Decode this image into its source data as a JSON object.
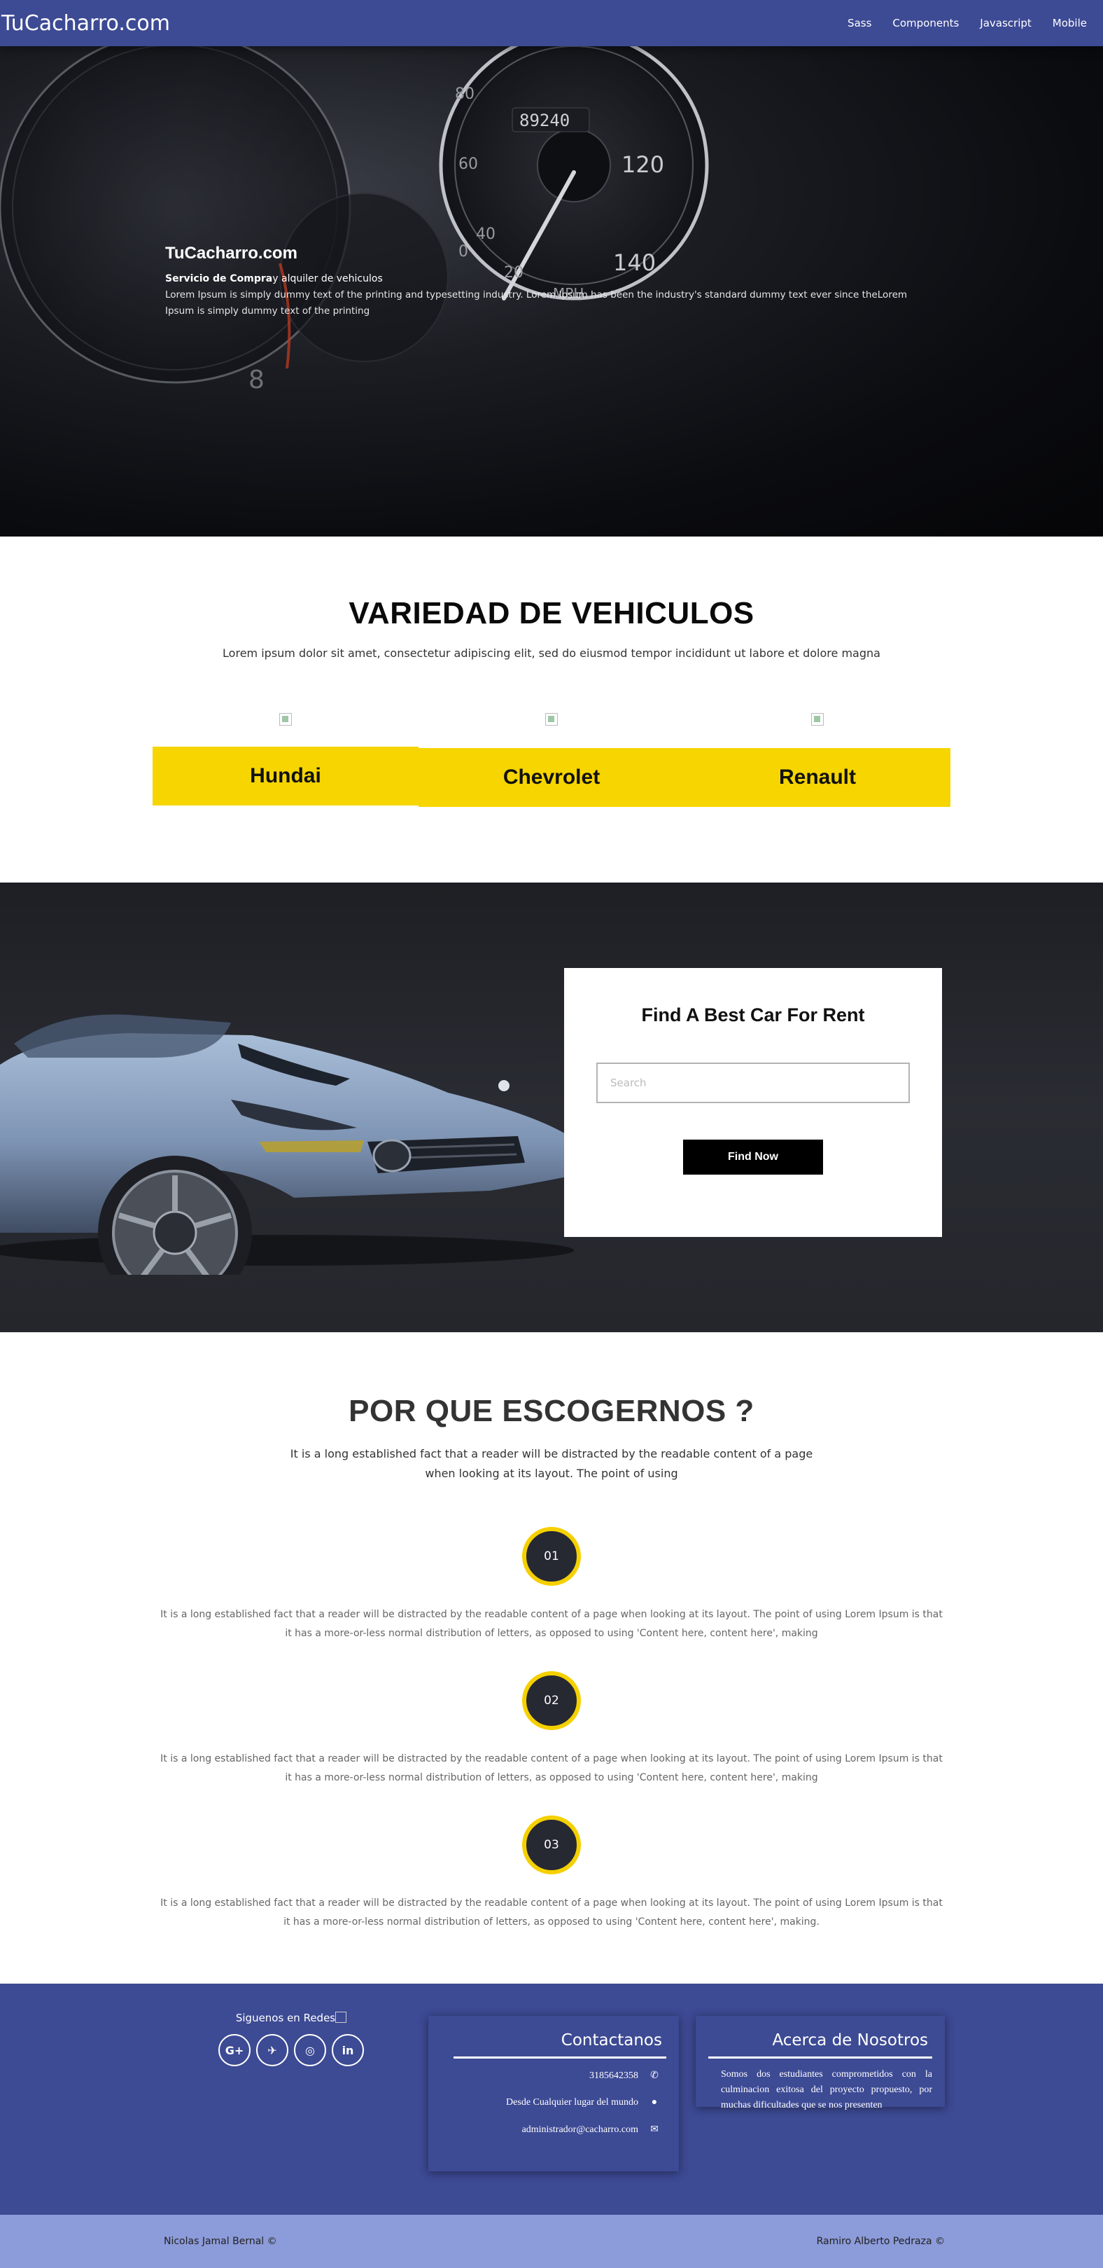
{
  "nav": {
    "brand": "TuCacharro.com",
    "links": [
      "Sass",
      "Components",
      "Javascript",
      "Mobile"
    ]
  },
  "hero": {
    "title": "TuCacharro.com",
    "subtitle_bold": "Servicio de Compra",
    "subtitle_rest": "y alquiler de vehiculos",
    "description": "Lorem Ipsum is simply dummy text of the printing and typesetting industry. Lorem Ipsum has been the industry's standard dummy text ever since theLorem Ipsum is simply dummy text of the printing",
    "gauge_digits": "89240",
    "gauge_marks": [
      "80",
      "60",
      "40",
      "20",
      "0",
      "120",
      "140",
      "MPH",
      "8"
    ]
  },
  "variedad": {
    "title": "VARIEDAD DE VEHICULOS",
    "subtitle": "Lorem ipsum dolor sit amet, consectetur adipiscing elit, sed do eiusmod tempor incididunt ut labore et dolore magna",
    "brands": [
      "Hundai",
      "Chevrolet",
      "Renault"
    ],
    "accent_color": "#f6d500"
  },
  "rent": {
    "title": "Find A Best Car For Rent",
    "search_placeholder": "Search",
    "button": "Find Now"
  },
  "why": {
    "title": "POR QUE ESCOGERNOS ?",
    "subtitle": "It is a long established fact that a reader will be distracted by the readable content of a page when looking at its layout. The point of using",
    "steps": [
      {
        "num": "01",
        "text": "It is a long established fact that a reader will be distracted by the readable content of a page when looking at its layout. The point of using Lorem Ipsum is that it has a more-or-less normal distribution of letters, as opposed to using 'Content here, content here', making"
      },
      {
        "num": "02",
        "text": "It is a long established fact that a reader will be distracted by the readable content of a page when looking at its layout. The point of using Lorem Ipsum is that it has a more-or-less normal distribution of letters, as opposed to using 'Content here, content here', making"
      },
      {
        "num": "03",
        "text": "It is a long established fact that a reader will be distracted by the readable content of a page when looking at its layout. The point of using Lorem Ipsum is that it has a more-or-less normal distribution of letters, as opposed to using 'Content here, content here', making."
      }
    ]
  },
  "footer": {
    "social_title": "Siguenos en Redes",
    "social_icons": [
      "google-plus-icon",
      "telegram-icon",
      "instagram-icon",
      "linkedin-icon"
    ],
    "social_glyphs": [
      "G+",
      "✈",
      "◎",
      "in"
    ],
    "contact_title": "Contactanos",
    "phone": "3185642358",
    "location": "Desde Cualquier lugar del mundo",
    "email": "administrador@cacharro.com",
    "about_title": "Acerca de Nosotros",
    "about_text": "Somos dos estudiantes comprometidos con la culminacion exitosa del proyecto propuesto, por muchas dificultades que se nos presenten",
    "author_left": "Nicolas Jamal Bernal ©",
    "author_right": "Ramiro Alberto Pedraza ©",
    "colors": {
      "primary": "#3d4a94",
      "bottom_bar": "#8c9bd9",
      "step_ring": "#f5d000"
    }
  }
}
